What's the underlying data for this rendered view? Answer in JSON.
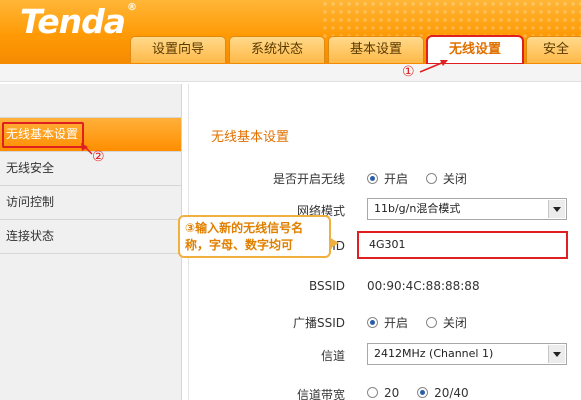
{
  "header": {
    "logo": "Tenda",
    "logo_mark": "®",
    "tabs": [
      "设置向导",
      "系统状态",
      "基本设置",
      "无线设置",
      "安全"
    ],
    "active_tab": "无线设置"
  },
  "sidebar": {
    "items": [
      "无线基本设置",
      "无线安全",
      "访问控制",
      "连接状态"
    ],
    "active_item": "无线基本设置"
  },
  "main": {
    "section_title": "无线基本设置",
    "wireless_enable": {
      "label": "是否开启无线",
      "options": [
        "开启",
        "关闭"
      ],
      "selected": "开启"
    },
    "network_mode": {
      "label": "网络模式",
      "value": "11b/g/n混合模式"
    },
    "ssid": {
      "label": "SSID",
      "value": "4G301"
    },
    "bssid": {
      "label": "BSSID",
      "value": "00:90:4C:88:88:88"
    },
    "broadcast_ssid": {
      "label": "广播SSID",
      "options": [
        "开启",
        "关闭"
      ],
      "selected": "开启"
    },
    "channel": {
      "label": "信道",
      "value": "2412MHz (Channel 1)"
    },
    "bandwidth": {
      "label": "信道带宽",
      "options": [
        "20",
        "20/40"
      ],
      "selected": "20/40"
    }
  },
  "annotations": {
    "step1": "①",
    "step2": "②",
    "step3_line1": "③输入新的无线信号名",
    "step3_line2": "称，字母、数字均可",
    "color": "#e02020"
  }
}
